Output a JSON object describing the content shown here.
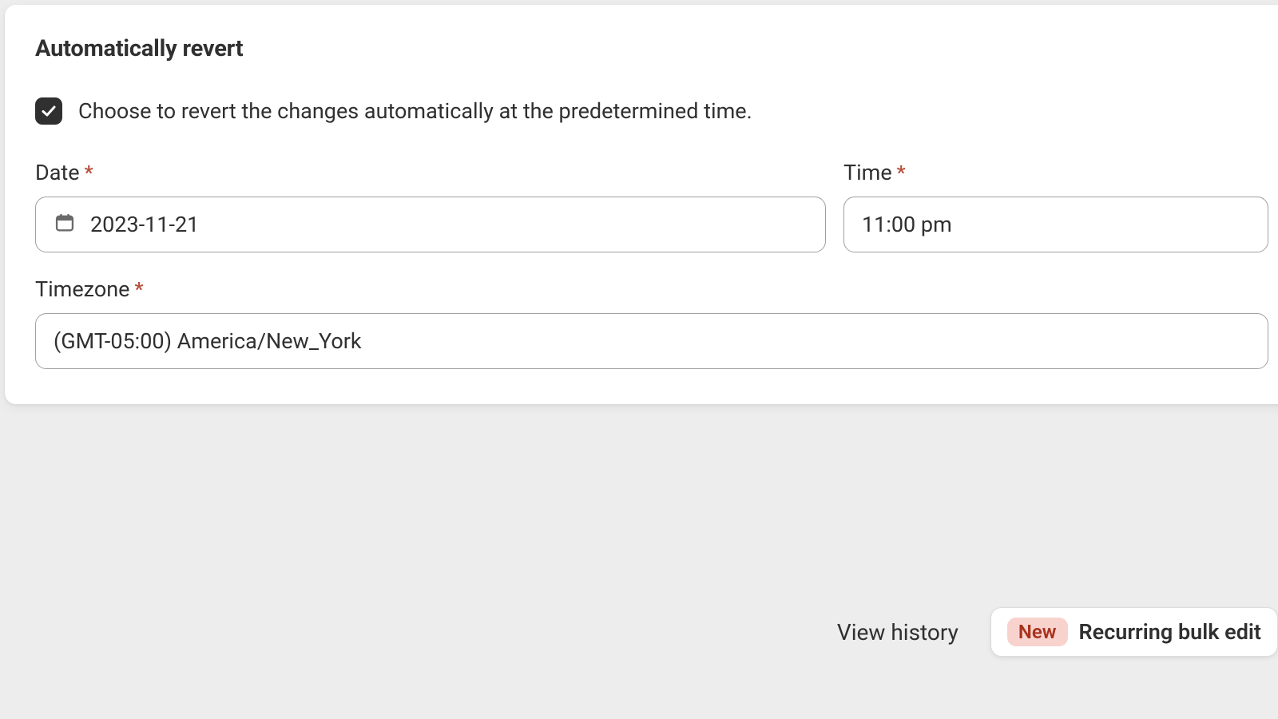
{
  "section": {
    "title": "Automatically revert",
    "checkbox_label": "Choose to revert the changes automatically at the predetermined time."
  },
  "fields": {
    "date": {
      "label": "Date",
      "value": "2023-11-21"
    },
    "time": {
      "label": "Time",
      "value": "11:00 pm"
    },
    "timezone": {
      "label": "Timezone",
      "value": "(GMT-05:00) America/New_York"
    }
  },
  "footer": {
    "view_history": "View history",
    "new_badge": "New",
    "recurring": "Recurring bulk edit"
  }
}
